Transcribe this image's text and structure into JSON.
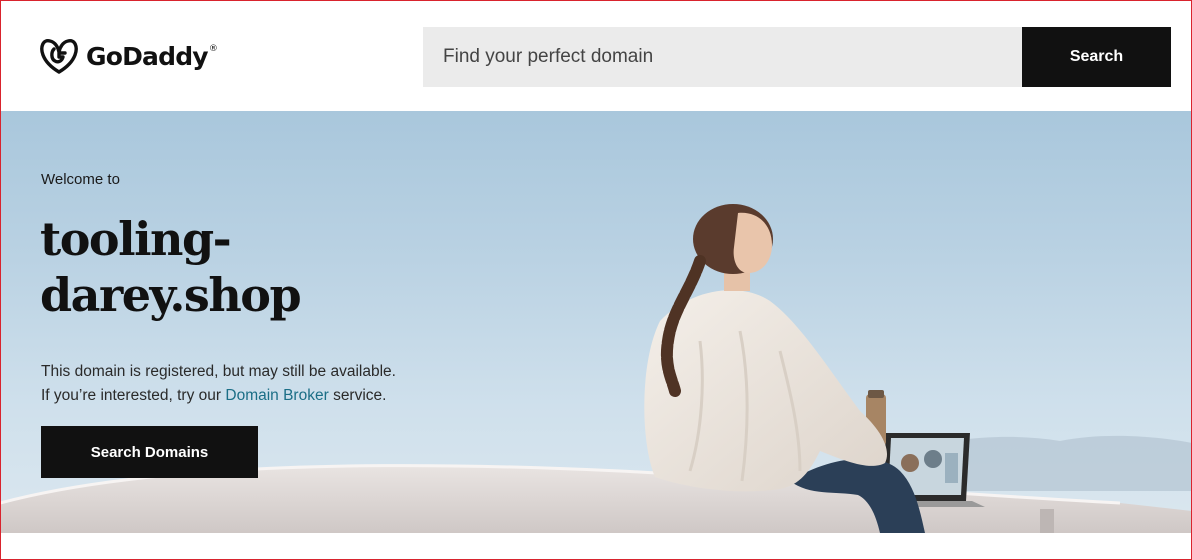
{
  "brand": {
    "name": "GoDaddy",
    "trademark": "®",
    "logo_icon": "godaddy-g-heart-icon"
  },
  "header": {
    "search_placeholder": "Find your perfect domain",
    "search_button": "Search"
  },
  "hero": {
    "welcome": "Welcome to",
    "domain": "tooling-darey.shop",
    "description_line1": "This domain is registered, but may still be available.",
    "description_line2_prefix": "If you’re interested, try our",
    "broker_link": "Domain Broker",
    "description_line2_suffix": "service.",
    "cta_button": "Search Domains"
  },
  "colors": {
    "accent_dark": "#111111",
    "link": "#1b6e86",
    "frame": "#d9232d",
    "search_bg": "#ebebeb"
  }
}
